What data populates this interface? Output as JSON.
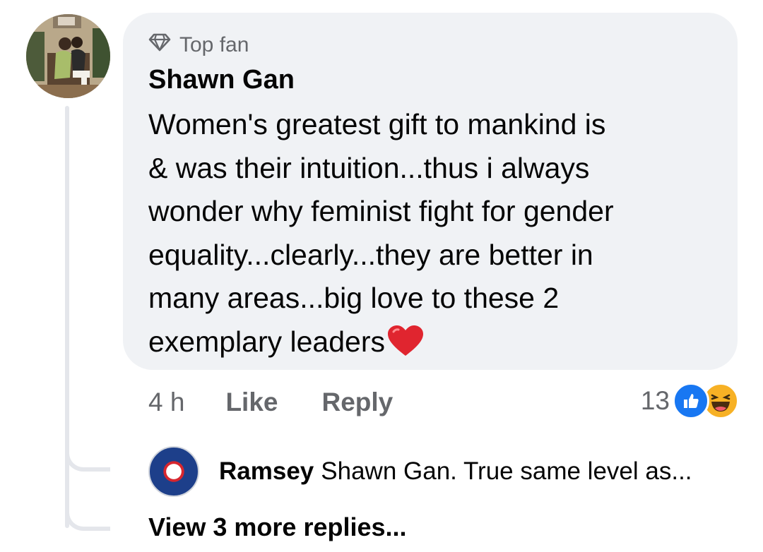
{
  "comment": {
    "badge_label": "Top fan",
    "badge_icon": "diamond-icon",
    "author": "Shawn Gan",
    "text": "Women's greatest gift to mankind is\n& was their intuition...thus i always\nwonder why feminist fight for gender\nequality...clearly...they are better in\nmany areas...big love to these 2\nexemplary leaders",
    "trailing_emoji": "heart-icon",
    "time": "4 h",
    "like_label": "Like",
    "reply_label": "Reply",
    "reaction_count": "13",
    "reaction_icons": [
      "like-icon",
      "haha-icon"
    ]
  },
  "reply": {
    "author": "Ramsey",
    "text": "Shawn Gan. True same level as..."
  },
  "view_more_label": "View 3 more replies...",
  "colors": {
    "bubble": "#f0f2f5",
    "secondary_text": "#65676b",
    "like_blue": "#1877f2",
    "haha_yellow": "#f7b125",
    "heart_red": "#e0252f",
    "thread_line": "#e4e6eb"
  }
}
